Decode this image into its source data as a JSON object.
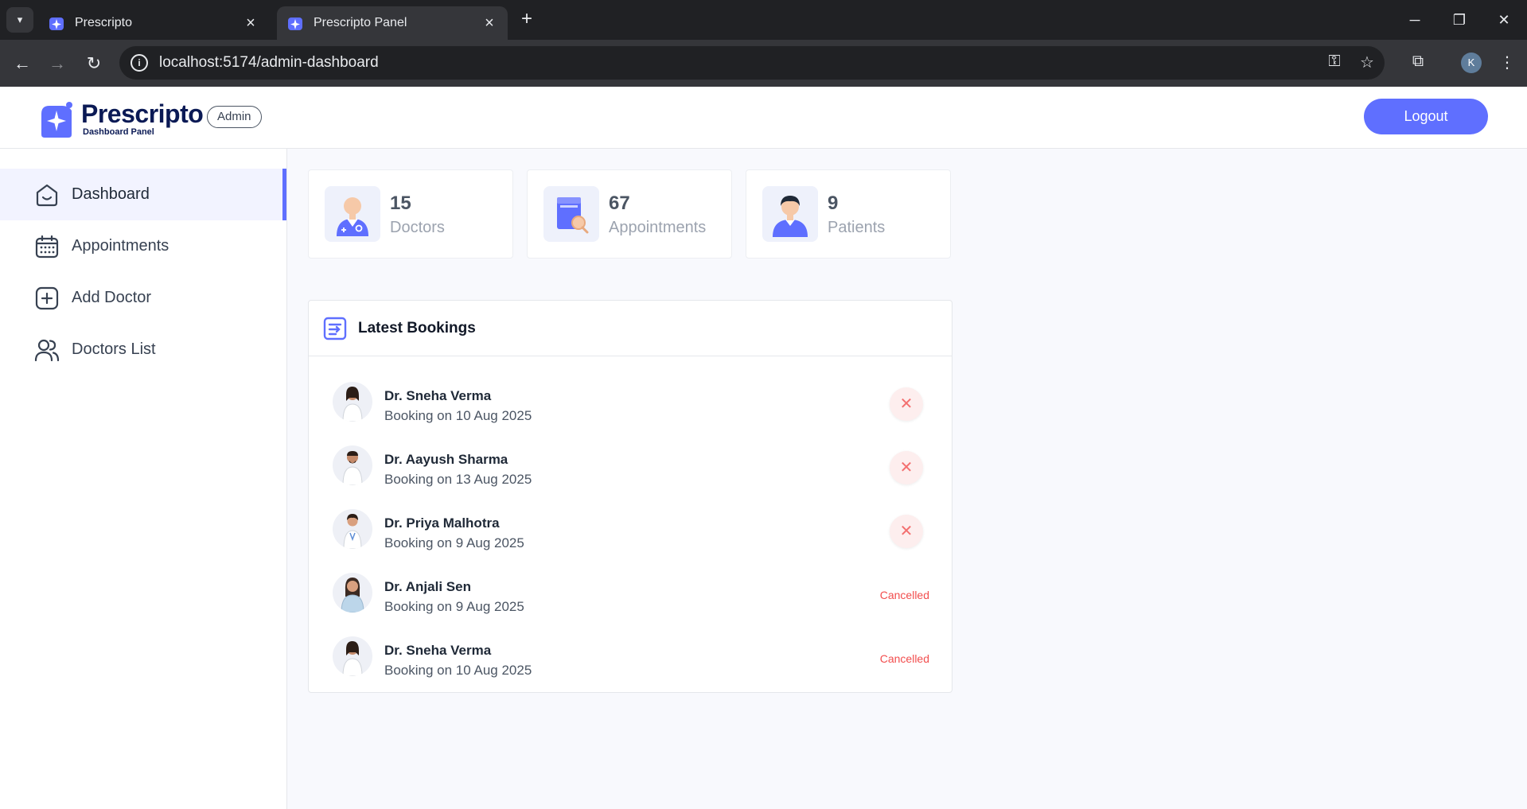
{
  "browser": {
    "tabs": [
      {
        "title": "Prescripto",
        "active": false
      },
      {
        "title": "Prescripto Panel",
        "active": true
      }
    ],
    "url": "localhost:5174/admin-dashboard",
    "profile_initial": "K"
  },
  "header": {
    "brand": "Prescripto",
    "brand_sub": "Dashboard Panel",
    "role": "Admin",
    "logout_label": "Logout"
  },
  "sidebar": {
    "items": [
      {
        "label": "Dashboard",
        "icon": "home-icon",
        "active": true
      },
      {
        "label": "Appointments",
        "icon": "calendar-icon",
        "active": false
      },
      {
        "label": "Add Doctor",
        "icon": "add-icon",
        "active": false
      },
      {
        "label": "Doctors List",
        "icon": "people-icon",
        "active": false
      }
    ]
  },
  "stats": [
    {
      "value": "15",
      "label": "Doctors",
      "icon": "doctor-icon"
    },
    {
      "value": "67",
      "label": "Appointments",
      "icon": "appointment-book-icon"
    },
    {
      "value": "9",
      "label": "Patients",
      "icon": "patient-icon"
    }
  ],
  "bookings": {
    "title": "Latest Bookings",
    "items": [
      {
        "doctor": "Dr. Sneha Verma",
        "date": "Booking on 10 Aug 2025",
        "status": "",
        "cancel_symbol": "✕"
      },
      {
        "doctor": "Dr. Aayush Sharma",
        "date": "Booking on 13 Aug 2025",
        "status": "",
        "cancel_symbol": "✕"
      },
      {
        "doctor": "Dr. Priya Malhotra",
        "date": "Booking on 9 Aug 2025",
        "status": "",
        "cancel_symbol": "✕"
      },
      {
        "doctor": "Dr. Anjali Sen",
        "date": "Booking on 9 Aug 2025",
        "status": "Cancelled"
      },
      {
        "doctor": "Dr. Sneha Verma",
        "date": "Booking on 10 Aug 2025",
        "status": "Cancelled"
      }
    ]
  },
  "colors": {
    "primary": "#5f6fff",
    "cancelled": "#f24d4d",
    "brand_text": "#0b1a55"
  }
}
